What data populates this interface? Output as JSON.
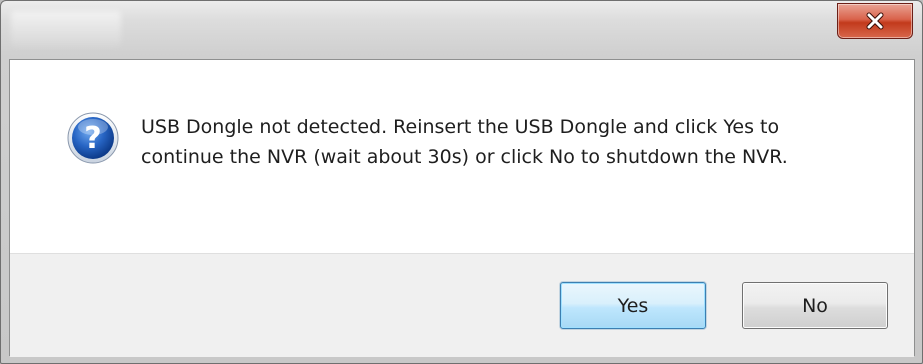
{
  "window": {
    "title": "",
    "close_icon": "close-icon"
  },
  "dialog": {
    "icon": "question-icon",
    "message": "USB Dongle not detected. Reinsert the USB Dongle and click Yes to continue the NVR (wait about 30s) or click No to shutdown the NVR."
  },
  "buttons": {
    "yes_label": "Yes",
    "no_label": "No"
  },
  "colors": {
    "close_red": "#c23a1c",
    "icon_blue": "#1f5fb8",
    "default_button_border": "#3c7fb1",
    "button_area": "#f0f0f0"
  }
}
